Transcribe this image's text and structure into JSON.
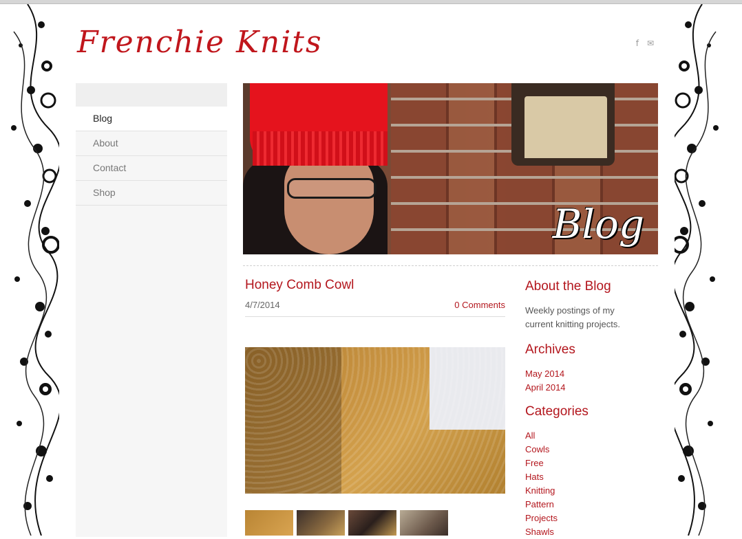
{
  "site": {
    "logo": "Frenchie Knits"
  },
  "social": {
    "facebook": "f",
    "email": "✉"
  },
  "nav": [
    {
      "label": "Blog",
      "active": true
    },
    {
      "label": "About"
    },
    {
      "label": "Contact"
    },
    {
      "label": "Shop"
    }
  ],
  "hero": {
    "label": "Blog"
  },
  "post": {
    "title": "Honey Comb Cowl",
    "date": "4/7/2014",
    "comments": "0 Comments"
  },
  "aside": {
    "about_title": "About the Blog",
    "about_text": "Weekly postings of my current knitting projects.",
    "archives_title": "Archives",
    "archives": [
      "May 2014",
      "April 2014"
    ],
    "categories_title": "Categories",
    "categories": [
      "All",
      "Cowls",
      "Free",
      "Hats",
      "Knitting",
      "Pattern",
      "Projects",
      "Shawls"
    ]
  },
  "colors": {
    "accent": "#b3161d",
    "logo": "#c0161c"
  },
  "icons": [
    "facebook-icon",
    "mail-icon"
  ]
}
